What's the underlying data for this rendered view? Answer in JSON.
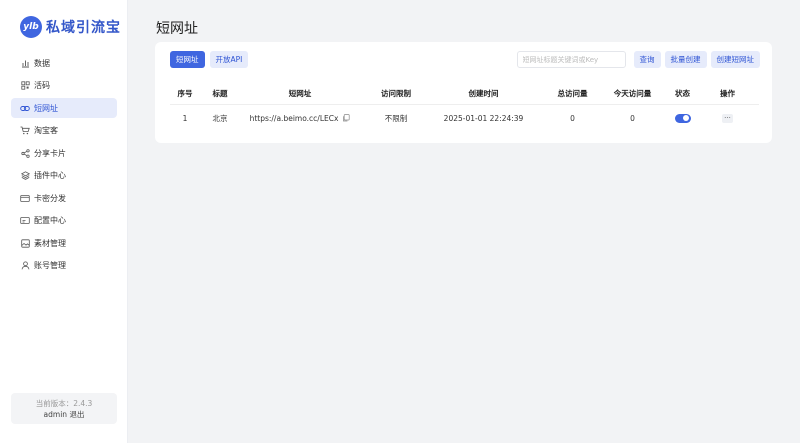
{
  "app": {
    "logo_badge": "ylb",
    "name": "私域引流宝"
  },
  "sidebar": {
    "items": [
      {
        "label": "数据",
        "icon": "bar-chart-icon"
      },
      {
        "label": "活码",
        "icon": "qrcode-icon"
      },
      {
        "label": "短网址",
        "icon": "link-icon",
        "active": true
      },
      {
        "label": "淘宝客",
        "icon": "cart-icon"
      },
      {
        "label": "分享卡片",
        "icon": "share-icon"
      },
      {
        "label": "插件中心",
        "icon": "layers-icon"
      },
      {
        "label": "卡密分发",
        "icon": "card-icon"
      },
      {
        "label": "配置中心",
        "icon": "config-icon"
      },
      {
        "label": "素材管理",
        "icon": "image-icon"
      },
      {
        "label": "账号管理",
        "icon": "user-icon"
      }
    ],
    "version_label": "当前版本：2.4.3",
    "user": "admin",
    "logout": "退出"
  },
  "page": {
    "title": "短网址"
  },
  "tabs": [
    {
      "label": "短网址",
      "active": true
    },
    {
      "label": "开放API",
      "active": false
    }
  ],
  "toolbar": {
    "search_placeholder": "短网址标题关键词或Key",
    "query": "查询",
    "batch_create": "批量创建",
    "create": "创建短网址"
  },
  "table": {
    "headers": [
      "序号",
      "标题",
      "短网址",
      "访问限制",
      "创建时间",
      "总访问量",
      "今天访问量",
      "状态",
      "操作"
    ],
    "rows": [
      {
        "index": "1",
        "title": "北京",
        "url": "https://a.beimo.cc/LECx",
        "limit": "不限制",
        "created": "2025-01-01 22:24:39",
        "total": "0",
        "today": "0",
        "status_on": true,
        "more": "···"
      }
    ]
  },
  "colors": {
    "accent": "#3f66e0",
    "accent_light": "#e6ebfb",
    "background": "#f2f3f5"
  }
}
